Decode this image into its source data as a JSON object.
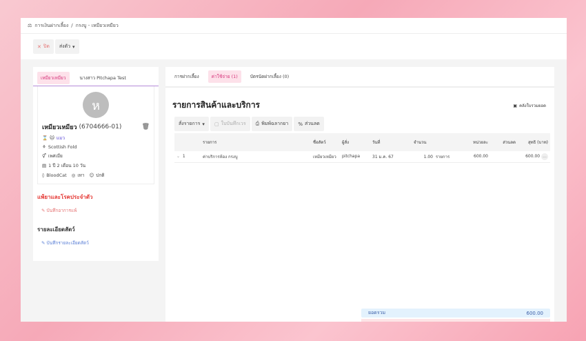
{
  "breadcrumb": {
    "root": "การเงินฝากเลี้ยง",
    "sep": "/",
    "current": "กรงบู - เหมียวเหมียว"
  },
  "toolbar": {
    "close": "ปิด",
    "send": "ส่งตัว"
  },
  "left": {
    "tabs": [
      "เหมียวเหมียว",
      "นางสาว Pitchapa Test"
    ],
    "avatar_letter": "ห",
    "pet_name": "เหมียวเหมียว",
    "pet_id": "(6704666-01)",
    "species": "แมว",
    "breed": "Scottish Fold",
    "sex": "เพศเมีย",
    "age": "1 ปี 2 เดือน 10 วัน",
    "blood": "BloodCat",
    "color": "เทา",
    "status": "ปกติ",
    "allergy_title": "แพ้ยาและโรคประจำตัว",
    "allergy_link": "บันทึกอาการแพ้",
    "detail_title": "รายละเอียดสัตว์",
    "detail_link": "บันทึกรายละเอียดสัตว์"
  },
  "right": {
    "tabs": [
      "การฝากเลี้ยง",
      "ค่าใช้จ่าย (1)",
      "บัตรนัดฝากเลี้ยง (0)"
    ],
    "title": "รายการสินค้าและบริการ",
    "summary_button": "คลังใบรวมยอด",
    "tools": {
      "order": "สั่งรายการ",
      "record": "ใบบันทึกเวร",
      "print": "พิมพ์ฉลากยา",
      "discount": "ส่วนลด"
    },
    "columns": [
      "",
      "รายการ",
      "ชื่อสัตว์",
      "ผู้สั่ง",
      "วันที่",
      "จำนวน",
      "หน่วยละ",
      "ส่วนลด",
      "สุทธิ (บาท)"
    ],
    "rows": [
      {
        "no": "1",
        "item": "ค่าบริการห้อง กรงบู",
        "pet": "เหมียวเหมียว",
        "by": "pitchapa",
        "date": "31 ม.ค. 67",
        "qty": "1.00",
        "unit": "รายการ",
        "price": "600.00",
        "discount": "",
        "net": "600.00"
      }
    ],
    "total_label": "ยอดรวม",
    "total_value": "600.00"
  }
}
